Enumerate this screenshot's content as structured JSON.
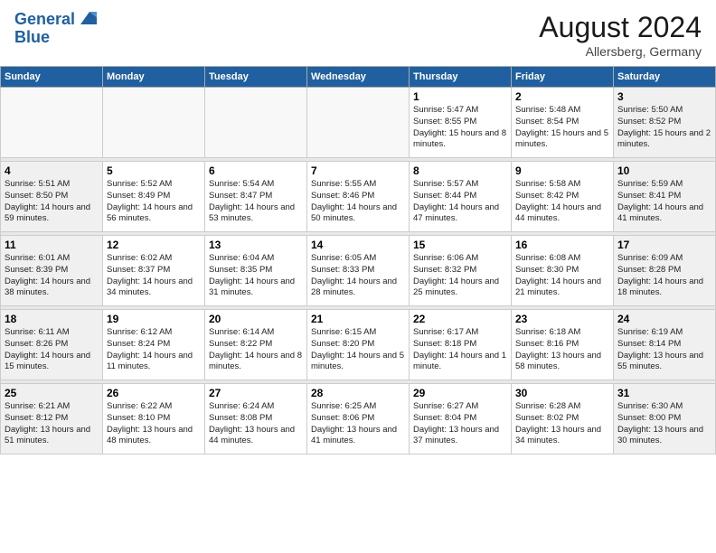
{
  "header": {
    "logo_line1": "General",
    "logo_line2": "Blue",
    "month_year": "August 2024",
    "location": "Allersberg, Germany"
  },
  "days_of_week": [
    "Sunday",
    "Monday",
    "Tuesday",
    "Wednesday",
    "Thursday",
    "Friday",
    "Saturday"
  ],
  "weeks": [
    [
      {
        "day": "",
        "sunrise": "",
        "sunset": "",
        "daylight": "",
        "empty": true
      },
      {
        "day": "",
        "sunrise": "",
        "sunset": "",
        "daylight": "",
        "empty": true
      },
      {
        "day": "",
        "sunrise": "",
        "sunset": "",
        "daylight": "",
        "empty": true
      },
      {
        "day": "",
        "sunrise": "",
        "sunset": "",
        "daylight": "",
        "empty": true
      },
      {
        "day": "1",
        "sunrise": "Sunrise: 5:47 AM",
        "sunset": "Sunset: 8:55 PM",
        "daylight": "Daylight: 15 hours and 8 minutes.",
        "empty": false
      },
      {
        "day": "2",
        "sunrise": "Sunrise: 5:48 AM",
        "sunset": "Sunset: 8:54 PM",
        "daylight": "Daylight: 15 hours and 5 minutes.",
        "empty": false
      },
      {
        "day": "3",
        "sunrise": "Sunrise: 5:50 AM",
        "sunset": "Sunset: 8:52 PM",
        "daylight": "Daylight: 15 hours and 2 minutes.",
        "empty": false,
        "weekend": true
      }
    ],
    [
      {
        "day": "4",
        "sunrise": "Sunrise: 5:51 AM",
        "sunset": "Sunset: 8:50 PM",
        "daylight": "Daylight: 14 hours and 59 minutes.",
        "empty": false,
        "weekend": true
      },
      {
        "day": "5",
        "sunrise": "Sunrise: 5:52 AM",
        "sunset": "Sunset: 8:49 PM",
        "daylight": "Daylight: 14 hours and 56 minutes.",
        "empty": false
      },
      {
        "day": "6",
        "sunrise": "Sunrise: 5:54 AM",
        "sunset": "Sunset: 8:47 PM",
        "daylight": "Daylight: 14 hours and 53 minutes.",
        "empty": false
      },
      {
        "day": "7",
        "sunrise": "Sunrise: 5:55 AM",
        "sunset": "Sunset: 8:46 PM",
        "daylight": "Daylight: 14 hours and 50 minutes.",
        "empty": false
      },
      {
        "day": "8",
        "sunrise": "Sunrise: 5:57 AM",
        "sunset": "Sunset: 8:44 PM",
        "daylight": "Daylight: 14 hours and 47 minutes.",
        "empty": false
      },
      {
        "day": "9",
        "sunrise": "Sunrise: 5:58 AM",
        "sunset": "Sunset: 8:42 PM",
        "daylight": "Daylight: 14 hours and 44 minutes.",
        "empty": false
      },
      {
        "day": "10",
        "sunrise": "Sunrise: 5:59 AM",
        "sunset": "Sunset: 8:41 PM",
        "daylight": "Daylight: 14 hours and 41 minutes.",
        "empty": false,
        "weekend": true
      }
    ],
    [
      {
        "day": "11",
        "sunrise": "Sunrise: 6:01 AM",
        "sunset": "Sunset: 8:39 PM",
        "daylight": "Daylight: 14 hours and 38 minutes.",
        "empty": false,
        "weekend": true
      },
      {
        "day": "12",
        "sunrise": "Sunrise: 6:02 AM",
        "sunset": "Sunset: 8:37 PM",
        "daylight": "Daylight: 14 hours and 34 minutes.",
        "empty": false
      },
      {
        "day": "13",
        "sunrise": "Sunrise: 6:04 AM",
        "sunset": "Sunset: 8:35 PM",
        "daylight": "Daylight: 14 hours and 31 minutes.",
        "empty": false
      },
      {
        "day": "14",
        "sunrise": "Sunrise: 6:05 AM",
        "sunset": "Sunset: 8:33 PM",
        "daylight": "Daylight: 14 hours and 28 minutes.",
        "empty": false
      },
      {
        "day": "15",
        "sunrise": "Sunrise: 6:06 AM",
        "sunset": "Sunset: 8:32 PM",
        "daylight": "Daylight: 14 hours and 25 minutes.",
        "empty": false
      },
      {
        "day": "16",
        "sunrise": "Sunrise: 6:08 AM",
        "sunset": "Sunset: 8:30 PM",
        "daylight": "Daylight: 14 hours and 21 minutes.",
        "empty": false
      },
      {
        "day": "17",
        "sunrise": "Sunrise: 6:09 AM",
        "sunset": "Sunset: 8:28 PM",
        "daylight": "Daylight: 14 hours and 18 minutes.",
        "empty": false,
        "weekend": true
      }
    ],
    [
      {
        "day": "18",
        "sunrise": "Sunrise: 6:11 AM",
        "sunset": "Sunset: 8:26 PM",
        "daylight": "Daylight: 14 hours and 15 minutes.",
        "empty": false,
        "weekend": true
      },
      {
        "day": "19",
        "sunrise": "Sunrise: 6:12 AM",
        "sunset": "Sunset: 8:24 PM",
        "daylight": "Daylight: 14 hours and 11 minutes.",
        "empty": false
      },
      {
        "day": "20",
        "sunrise": "Sunrise: 6:14 AM",
        "sunset": "Sunset: 8:22 PM",
        "daylight": "Daylight: 14 hours and 8 minutes.",
        "empty": false
      },
      {
        "day": "21",
        "sunrise": "Sunrise: 6:15 AM",
        "sunset": "Sunset: 8:20 PM",
        "daylight": "Daylight: 14 hours and 5 minutes.",
        "empty": false
      },
      {
        "day": "22",
        "sunrise": "Sunrise: 6:17 AM",
        "sunset": "Sunset: 8:18 PM",
        "daylight": "Daylight: 14 hours and 1 minute.",
        "empty": false
      },
      {
        "day": "23",
        "sunrise": "Sunrise: 6:18 AM",
        "sunset": "Sunset: 8:16 PM",
        "daylight": "Daylight: 13 hours and 58 minutes.",
        "empty": false
      },
      {
        "day": "24",
        "sunrise": "Sunrise: 6:19 AM",
        "sunset": "Sunset: 8:14 PM",
        "daylight": "Daylight: 13 hours and 55 minutes.",
        "empty": false,
        "weekend": true
      }
    ],
    [
      {
        "day": "25",
        "sunrise": "Sunrise: 6:21 AM",
        "sunset": "Sunset: 8:12 PM",
        "daylight": "Daylight: 13 hours and 51 minutes.",
        "empty": false,
        "weekend": true
      },
      {
        "day": "26",
        "sunrise": "Sunrise: 6:22 AM",
        "sunset": "Sunset: 8:10 PM",
        "daylight": "Daylight: 13 hours and 48 minutes.",
        "empty": false
      },
      {
        "day": "27",
        "sunrise": "Sunrise: 6:24 AM",
        "sunset": "Sunset: 8:08 PM",
        "daylight": "Daylight: 13 hours and 44 minutes.",
        "empty": false
      },
      {
        "day": "28",
        "sunrise": "Sunrise: 6:25 AM",
        "sunset": "Sunset: 8:06 PM",
        "daylight": "Daylight: 13 hours and 41 minutes.",
        "empty": false
      },
      {
        "day": "29",
        "sunrise": "Sunrise: 6:27 AM",
        "sunset": "Sunset: 8:04 PM",
        "daylight": "Daylight: 13 hours and 37 minutes.",
        "empty": false
      },
      {
        "day": "30",
        "sunrise": "Sunrise: 6:28 AM",
        "sunset": "Sunset: 8:02 PM",
        "daylight": "Daylight: 13 hours and 34 minutes.",
        "empty": false
      },
      {
        "day": "31",
        "sunrise": "Sunrise: 6:30 AM",
        "sunset": "Sunset: 8:00 PM",
        "daylight": "Daylight: 13 hours and 30 minutes.",
        "empty": false,
        "weekend": true
      }
    ]
  ]
}
